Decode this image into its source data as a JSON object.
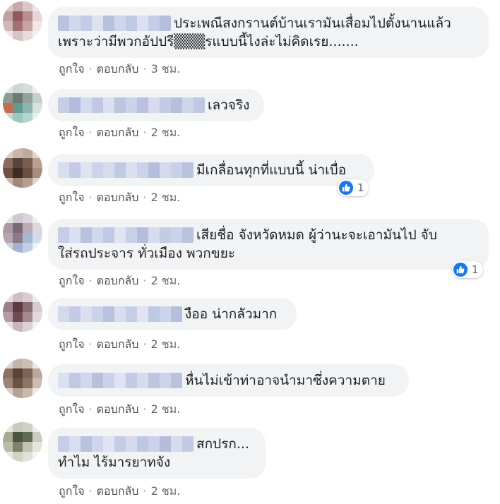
{
  "actions": {
    "like": "ถูกใจ",
    "reply": "ตอบกลับ",
    "sep": "·"
  },
  "comments": [
    {
      "lines": [
        "ประเพณีสงกรานต์บ้านเรามันเสื่อมไปตั้งนานแล้ว",
        "เพราะว่ามีพวกอัปปรี▒▒▒รแบบนี้ไงล่ะไม่คิดเรย......."
      ],
      "time": "3 ชม."
    },
    {
      "lines": [
        "เลวจริง"
      ],
      "time": "2 ชม."
    },
    {
      "lines": [
        "มีเกลื่อนทุกที่แบบนี้ น่าเบื่อ"
      ],
      "time": "2 ชม.",
      "likes": "1"
    },
    {
      "lines": [
        "เสียชื่อ จังหวัดหมด ผู้ว่านะจะเอามันไป จับ",
        "ใส่รถประจาร ทั่วเมือง พวกขยะ"
      ],
      "time": "2 ชม.",
      "likes": "1"
    },
    {
      "lines": [
        "งืออ น่ากลัวมาก"
      ],
      "time": "2 ชม."
    },
    {
      "lines": [
        "หื่นไม่เข้าท่าอาจนำมาซึ่งความตาย"
      ],
      "time": "2 ชม."
    },
    {
      "lines": [
        "สกปรก...",
        "ทำไม ไร้มารยาทจัง"
      ],
      "time": "2 ชม."
    }
  ],
  "colors": {
    "bubble": "#f2f3f5",
    "like_blue": "#1877f2",
    "meta": "#606770"
  },
  "icons": {
    "like": "thumbs-up-icon"
  }
}
